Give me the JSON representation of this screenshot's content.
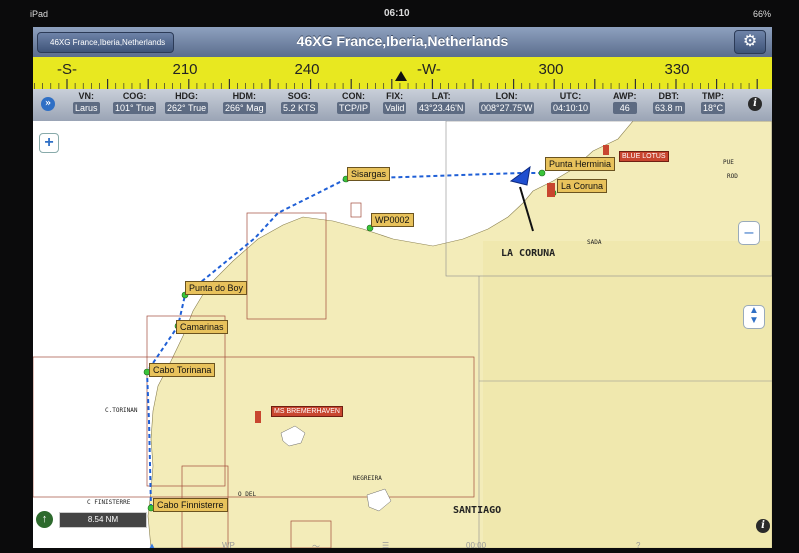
{
  "status_bar": {
    "device": "iPad",
    "time": "06:10",
    "battery": "66%"
  },
  "header": {
    "back_label": "46XG France,Iberia,Netherlands",
    "title": "46XG France,Iberia,Netherlands"
  },
  "compass": {
    "labels": [
      {
        "text": "-S-",
        "deg": 180
      },
      {
        "text": "210",
        "deg": 210
      },
      {
        "text": "240",
        "deg": 240
      },
      {
        "text": "-W-",
        "deg": 270
      },
      {
        "text": "300",
        "deg": 300
      },
      {
        "text": "330",
        "deg": 330
      }
    ],
    "heading_deg": 262
  },
  "data": [
    {
      "label": "VN:",
      "value": "Larus"
    },
    {
      "label": "COG:",
      "value": "101° True"
    },
    {
      "label": "HDG:",
      "value": "262° True"
    },
    {
      "label": "HDM:",
      "value": "266° Mag"
    },
    {
      "label": "SOG:",
      "value": "5.2 KTS"
    },
    {
      "label": "CON:",
      "value": "TCP/IP"
    },
    {
      "label": "FIX:",
      "value": "Valid"
    },
    {
      "label": "LAT:",
      "value": "43°23.46'N"
    },
    {
      "label": "LON:",
      "value": "008°27.75'W"
    },
    {
      "label": "UTC:",
      "value": "04:10:10"
    },
    {
      "label": "AWP:",
      "value": "46"
    },
    {
      "label": "DBT:",
      "value": "63.8 m"
    },
    {
      "label": "TMP:",
      "value": "18°C"
    }
  ],
  "waypoints": [
    {
      "name": "Sisargas"
    },
    {
      "name": "WP0002"
    },
    {
      "name": "Punta Herminia"
    },
    {
      "name": "La Coruna"
    },
    {
      "name": "Punta do Boy"
    },
    {
      "name": "Camarinas"
    },
    {
      "name": "Cabo Torinana"
    },
    {
      "name": "Cabo Finnisterre"
    }
  ],
  "vessels": [
    {
      "name": "BLUE LOTUS"
    },
    {
      "name": "MS BREMERHAVEN"
    }
  ],
  "map_text": {
    "la_coruna": "LA CORUNA",
    "santiago": "SANTIAGO",
    "c_torinan": "C.TORINAN",
    "c_finisterre": "C FINISTERRE",
    "negreira": "NEGREIRA",
    "to_del": "O DEL",
    "sada": "SADA",
    "puerto": "PUE",
    "rodeiros": "ROD"
  },
  "scale_label": "8.54 NM",
  "bottom_bar": {
    "wp_label": "WP",
    "time_label": "00:00"
  }
}
